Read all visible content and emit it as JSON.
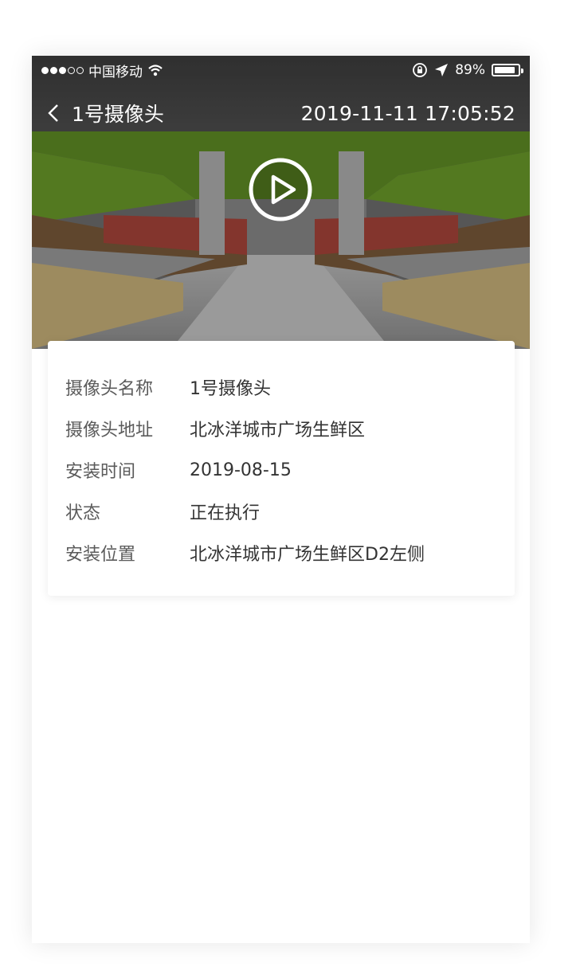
{
  "status_bar": {
    "carrier": "中国移动",
    "battery_percent": "89%",
    "battery_level": 0.89,
    "signal_filled": 3,
    "signal_total": 5
  },
  "nav": {
    "title": "1号摄像头",
    "timestamp": "2019-11-11  17:05:52"
  },
  "colors": {
    "accent_green": "#7bb42c",
    "label_gray": "#5b5b5b",
    "value_dark": "#333333"
  },
  "icons": {
    "back": "chevron-left-icon",
    "play": "play-icon",
    "wifi": "wifi-icon",
    "location": "location-arrow-icon",
    "orientation_lock": "orientation-lock-icon",
    "battery": "battery-icon"
  },
  "info": {
    "rows": [
      {
        "label": "摄像头名称",
        "value": "1号摄像头"
      },
      {
        "label": "摄像头地址",
        "value": "北冰洋城市广场生鲜区"
      },
      {
        "label": "安装时间",
        "value": "2019-08-15"
      },
      {
        "label": "状态",
        "value": "正在执行"
      },
      {
        "label": "安装位置",
        "value": "北冰洋城市广场生鲜区D2左侧"
      }
    ]
  }
}
